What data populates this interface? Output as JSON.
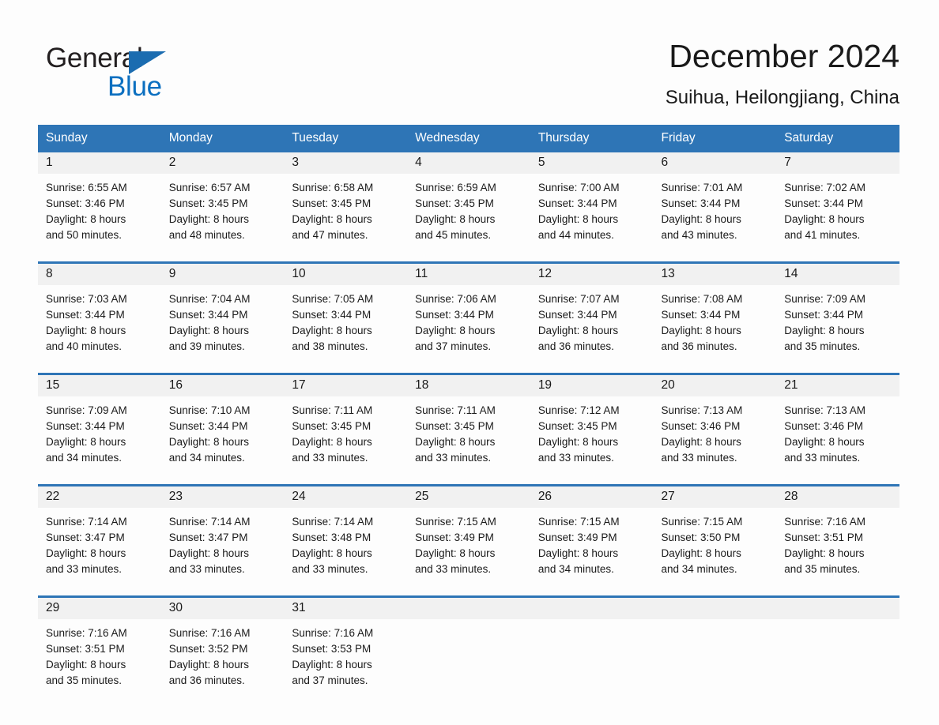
{
  "brand": {
    "line1": "General",
    "line2": "Blue",
    "logo_icon": "triangle-flag-icon",
    "accent_color": "#1b6cb0",
    "blue_text_color": "#0b6fc0"
  },
  "header": {
    "title": "December 2024",
    "subtitle": "Suihua, Heilongjiang, China"
  },
  "theme": {
    "header_blue": "#2e75b6",
    "date_band": "#f1f1f1",
    "text": "#1a1a1a",
    "page_background": "#fdfdfd"
  },
  "weekday_headers": [
    "Sunday",
    "Monday",
    "Tuesday",
    "Wednesday",
    "Thursday",
    "Friday",
    "Saturday"
  ],
  "weeks": [
    {
      "days": [
        {
          "date": "1",
          "sunrise": "Sunrise: 6:55 AM",
          "sunset": "Sunset: 3:46 PM",
          "daylight_1": "Daylight: 8 hours",
          "daylight_2": "and 50 minutes."
        },
        {
          "date": "2",
          "sunrise": "Sunrise: 6:57 AM",
          "sunset": "Sunset: 3:45 PM",
          "daylight_1": "Daylight: 8 hours",
          "daylight_2": "and 48 minutes."
        },
        {
          "date": "3",
          "sunrise": "Sunrise: 6:58 AM",
          "sunset": "Sunset: 3:45 PM",
          "daylight_1": "Daylight: 8 hours",
          "daylight_2": "and 47 minutes."
        },
        {
          "date": "4",
          "sunrise": "Sunrise: 6:59 AM",
          "sunset": "Sunset: 3:45 PM",
          "daylight_1": "Daylight: 8 hours",
          "daylight_2": "and 45 minutes."
        },
        {
          "date": "5",
          "sunrise": "Sunrise: 7:00 AM",
          "sunset": "Sunset: 3:44 PM",
          "daylight_1": "Daylight: 8 hours",
          "daylight_2": "and 44 minutes."
        },
        {
          "date": "6",
          "sunrise": "Sunrise: 7:01 AM",
          "sunset": "Sunset: 3:44 PM",
          "daylight_1": "Daylight: 8 hours",
          "daylight_2": "and 43 minutes."
        },
        {
          "date": "7",
          "sunrise": "Sunrise: 7:02 AM",
          "sunset": "Sunset: 3:44 PM",
          "daylight_1": "Daylight: 8 hours",
          "daylight_2": "and 41 minutes."
        }
      ]
    },
    {
      "days": [
        {
          "date": "8",
          "sunrise": "Sunrise: 7:03 AM",
          "sunset": "Sunset: 3:44 PM",
          "daylight_1": "Daylight: 8 hours",
          "daylight_2": "and 40 minutes."
        },
        {
          "date": "9",
          "sunrise": "Sunrise: 7:04 AM",
          "sunset": "Sunset: 3:44 PM",
          "daylight_1": "Daylight: 8 hours",
          "daylight_2": "and 39 minutes."
        },
        {
          "date": "10",
          "sunrise": "Sunrise: 7:05 AM",
          "sunset": "Sunset: 3:44 PM",
          "daylight_1": "Daylight: 8 hours",
          "daylight_2": "and 38 minutes."
        },
        {
          "date": "11",
          "sunrise": "Sunrise: 7:06 AM",
          "sunset": "Sunset: 3:44 PM",
          "daylight_1": "Daylight: 8 hours",
          "daylight_2": "and 37 minutes."
        },
        {
          "date": "12",
          "sunrise": "Sunrise: 7:07 AM",
          "sunset": "Sunset: 3:44 PM",
          "daylight_1": "Daylight: 8 hours",
          "daylight_2": "and 36 minutes."
        },
        {
          "date": "13",
          "sunrise": "Sunrise: 7:08 AM",
          "sunset": "Sunset: 3:44 PM",
          "daylight_1": "Daylight: 8 hours",
          "daylight_2": "and 36 minutes."
        },
        {
          "date": "14",
          "sunrise": "Sunrise: 7:09 AM",
          "sunset": "Sunset: 3:44 PM",
          "daylight_1": "Daylight: 8 hours",
          "daylight_2": "and 35 minutes."
        }
      ]
    },
    {
      "days": [
        {
          "date": "15",
          "sunrise": "Sunrise: 7:09 AM",
          "sunset": "Sunset: 3:44 PM",
          "daylight_1": "Daylight: 8 hours",
          "daylight_2": "and 34 minutes."
        },
        {
          "date": "16",
          "sunrise": "Sunrise: 7:10 AM",
          "sunset": "Sunset: 3:44 PM",
          "daylight_1": "Daylight: 8 hours",
          "daylight_2": "and 34 minutes."
        },
        {
          "date": "17",
          "sunrise": "Sunrise: 7:11 AM",
          "sunset": "Sunset: 3:45 PM",
          "daylight_1": "Daylight: 8 hours",
          "daylight_2": "and 33 minutes."
        },
        {
          "date": "18",
          "sunrise": "Sunrise: 7:11 AM",
          "sunset": "Sunset: 3:45 PM",
          "daylight_1": "Daylight: 8 hours",
          "daylight_2": "and 33 minutes."
        },
        {
          "date": "19",
          "sunrise": "Sunrise: 7:12 AM",
          "sunset": "Sunset: 3:45 PM",
          "daylight_1": "Daylight: 8 hours",
          "daylight_2": "and 33 minutes."
        },
        {
          "date": "20",
          "sunrise": "Sunrise: 7:13 AM",
          "sunset": "Sunset: 3:46 PM",
          "daylight_1": "Daylight: 8 hours",
          "daylight_2": "and 33 minutes."
        },
        {
          "date": "21",
          "sunrise": "Sunrise: 7:13 AM",
          "sunset": "Sunset: 3:46 PM",
          "daylight_1": "Daylight: 8 hours",
          "daylight_2": "and 33 minutes."
        }
      ]
    },
    {
      "days": [
        {
          "date": "22",
          "sunrise": "Sunrise: 7:14 AM",
          "sunset": "Sunset: 3:47 PM",
          "daylight_1": "Daylight: 8 hours",
          "daylight_2": "and 33 minutes."
        },
        {
          "date": "23",
          "sunrise": "Sunrise: 7:14 AM",
          "sunset": "Sunset: 3:47 PM",
          "daylight_1": "Daylight: 8 hours",
          "daylight_2": "and 33 minutes."
        },
        {
          "date": "24",
          "sunrise": "Sunrise: 7:14 AM",
          "sunset": "Sunset: 3:48 PM",
          "daylight_1": "Daylight: 8 hours",
          "daylight_2": "and 33 minutes."
        },
        {
          "date": "25",
          "sunrise": "Sunrise: 7:15 AM",
          "sunset": "Sunset: 3:49 PM",
          "daylight_1": "Daylight: 8 hours",
          "daylight_2": "and 33 minutes."
        },
        {
          "date": "26",
          "sunrise": "Sunrise: 7:15 AM",
          "sunset": "Sunset: 3:49 PM",
          "daylight_1": "Daylight: 8 hours",
          "daylight_2": "and 34 minutes."
        },
        {
          "date": "27",
          "sunrise": "Sunrise: 7:15 AM",
          "sunset": "Sunset: 3:50 PM",
          "daylight_1": "Daylight: 8 hours",
          "daylight_2": "and 34 minutes."
        },
        {
          "date": "28",
          "sunrise": "Sunrise: 7:16 AM",
          "sunset": "Sunset: 3:51 PM",
          "daylight_1": "Daylight: 8 hours",
          "daylight_2": "and 35 minutes."
        }
      ]
    },
    {
      "days": [
        {
          "date": "29",
          "sunrise": "Sunrise: 7:16 AM",
          "sunset": "Sunset: 3:51 PM",
          "daylight_1": "Daylight: 8 hours",
          "daylight_2": "and 35 minutes."
        },
        {
          "date": "30",
          "sunrise": "Sunrise: 7:16 AM",
          "sunset": "Sunset: 3:52 PM",
          "daylight_1": "Daylight: 8 hours",
          "daylight_2": "and 36 minutes."
        },
        {
          "date": "31",
          "sunrise": "Sunrise: 7:16 AM",
          "sunset": "Sunset: 3:53 PM",
          "daylight_1": "Daylight: 8 hours",
          "daylight_2": "and 37 minutes."
        },
        {
          "date": "",
          "sunrise": "",
          "sunset": "",
          "daylight_1": "",
          "daylight_2": ""
        },
        {
          "date": "",
          "sunrise": "",
          "sunset": "",
          "daylight_1": "",
          "daylight_2": ""
        },
        {
          "date": "",
          "sunrise": "",
          "sunset": "",
          "daylight_1": "",
          "daylight_2": ""
        },
        {
          "date": "",
          "sunrise": "",
          "sunset": "",
          "daylight_1": "",
          "daylight_2": ""
        }
      ]
    }
  ]
}
